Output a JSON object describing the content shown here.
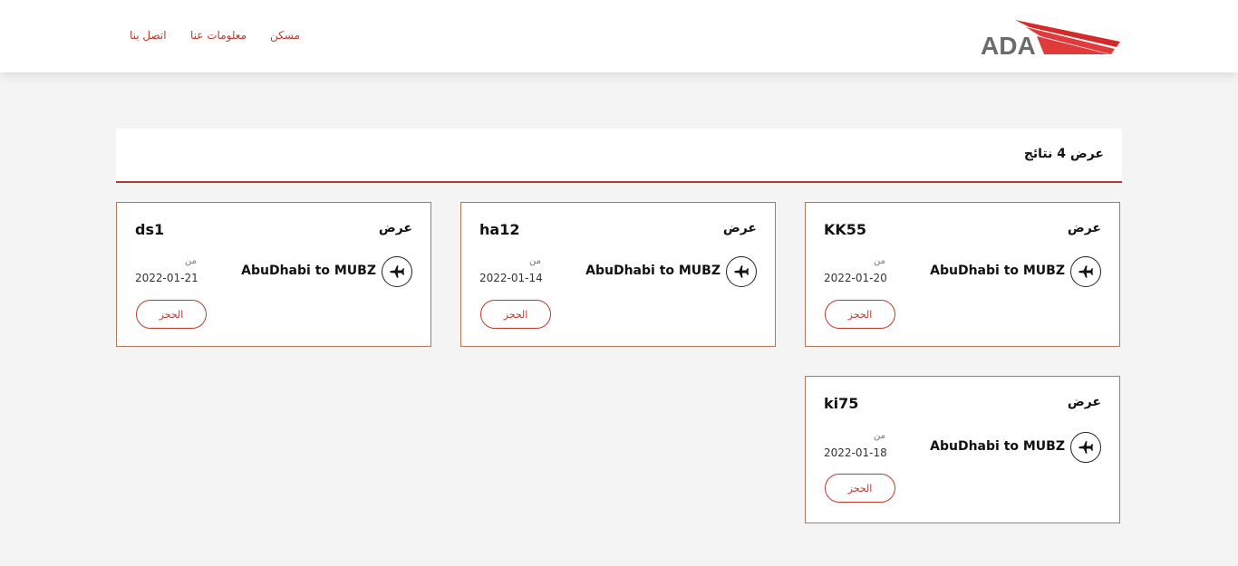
{
  "header": {
    "nav": [
      {
        "label": "مسكن"
      },
      {
        "label": "معلومات عنا"
      },
      {
        "label": "اتصل بنا"
      }
    ],
    "logo_text": "ADA",
    "accent_color": "#c0392b"
  },
  "results": {
    "summary": "عرض 4 نتائج"
  },
  "cards": [
    {
      "offer_label": "عرض",
      "code": "KK55",
      "route": "AbuDhabi to MUBZ",
      "from_label": "من",
      "date": "2022-01-20",
      "book_label": "الحجز",
      "icon": "airplane-icon"
    },
    {
      "offer_label": "عرض",
      "code": "ha12",
      "route": "AbuDhabi to MUBZ",
      "from_label": "من",
      "date": "2022-01-14",
      "book_label": "الحجز",
      "icon": "airplane-icon"
    },
    {
      "offer_label": "عرض",
      "code": "ds1",
      "route": "AbuDhabi to MUBZ",
      "from_label": "من",
      "date": "2022-01-21",
      "book_label": "الحجز",
      "icon": "airplane-icon"
    },
    {
      "offer_label": "عرض",
      "code": "ki75",
      "route": "AbuDhabi to MUBZ",
      "from_label": "من",
      "date": "2022-01-18",
      "book_label": "الحجز",
      "icon": "airplane-icon"
    }
  ]
}
